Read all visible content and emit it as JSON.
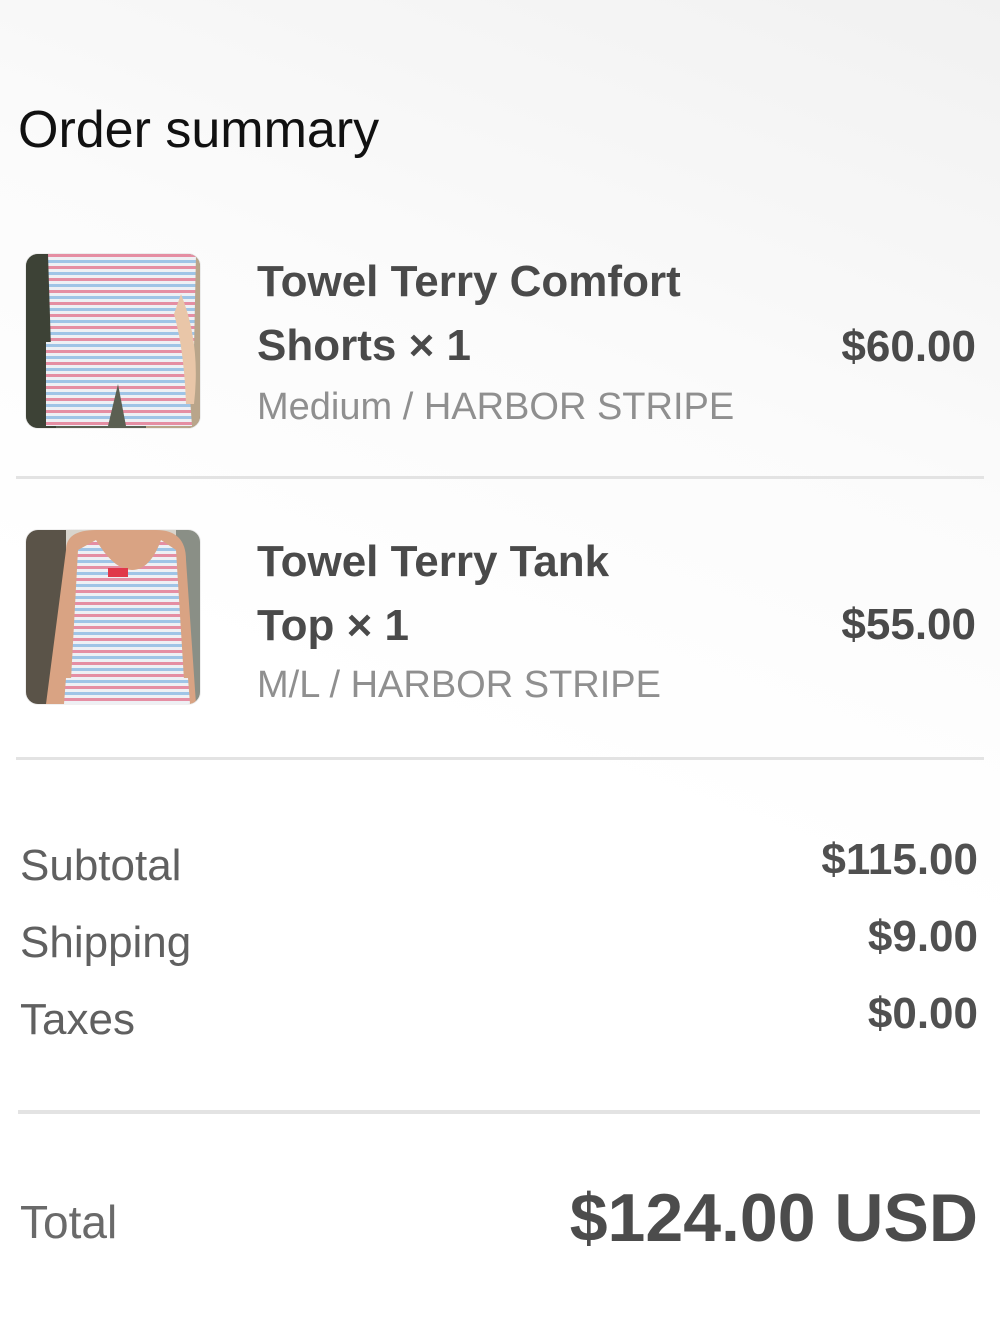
{
  "header": {
    "title": "Order summary"
  },
  "items": [
    {
      "name_line1": "Towel Terry Comfort",
      "name_line2": "Shorts × 1",
      "variant": "Medium / HARBOR STRIPE",
      "price": "$60.00",
      "image": "striped-shorts-photo"
    },
    {
      "name_line1": "Towel Terry Tank",
      "name_line2": "Top × 1",
      "variant": "M/L / HARBOR STRIPE",
      "price": "$55.00",
      "image": "striped-tank-top-photo"
    }
  ],
  "summary": {
    "subtotal_label": "Subtotal",
    "subtotal_value": "$115.00",
    "shipping_label": "Shipping",
    "shipping_value": "$9.00",
    "taxes_label": "Taxes",
    "taxes_value": "$0.00"
  },
  "total": {
    "label": "Total",
    "value": "$124.00 USD"
  },
  "colors": {
    "stripe_pink": "#e58ea3",
    "stripe_blue": "#9fc4e6",
    "text_dark": "#4a4a4a",
    "text_muted": "#8f8f8f"
  }
}
